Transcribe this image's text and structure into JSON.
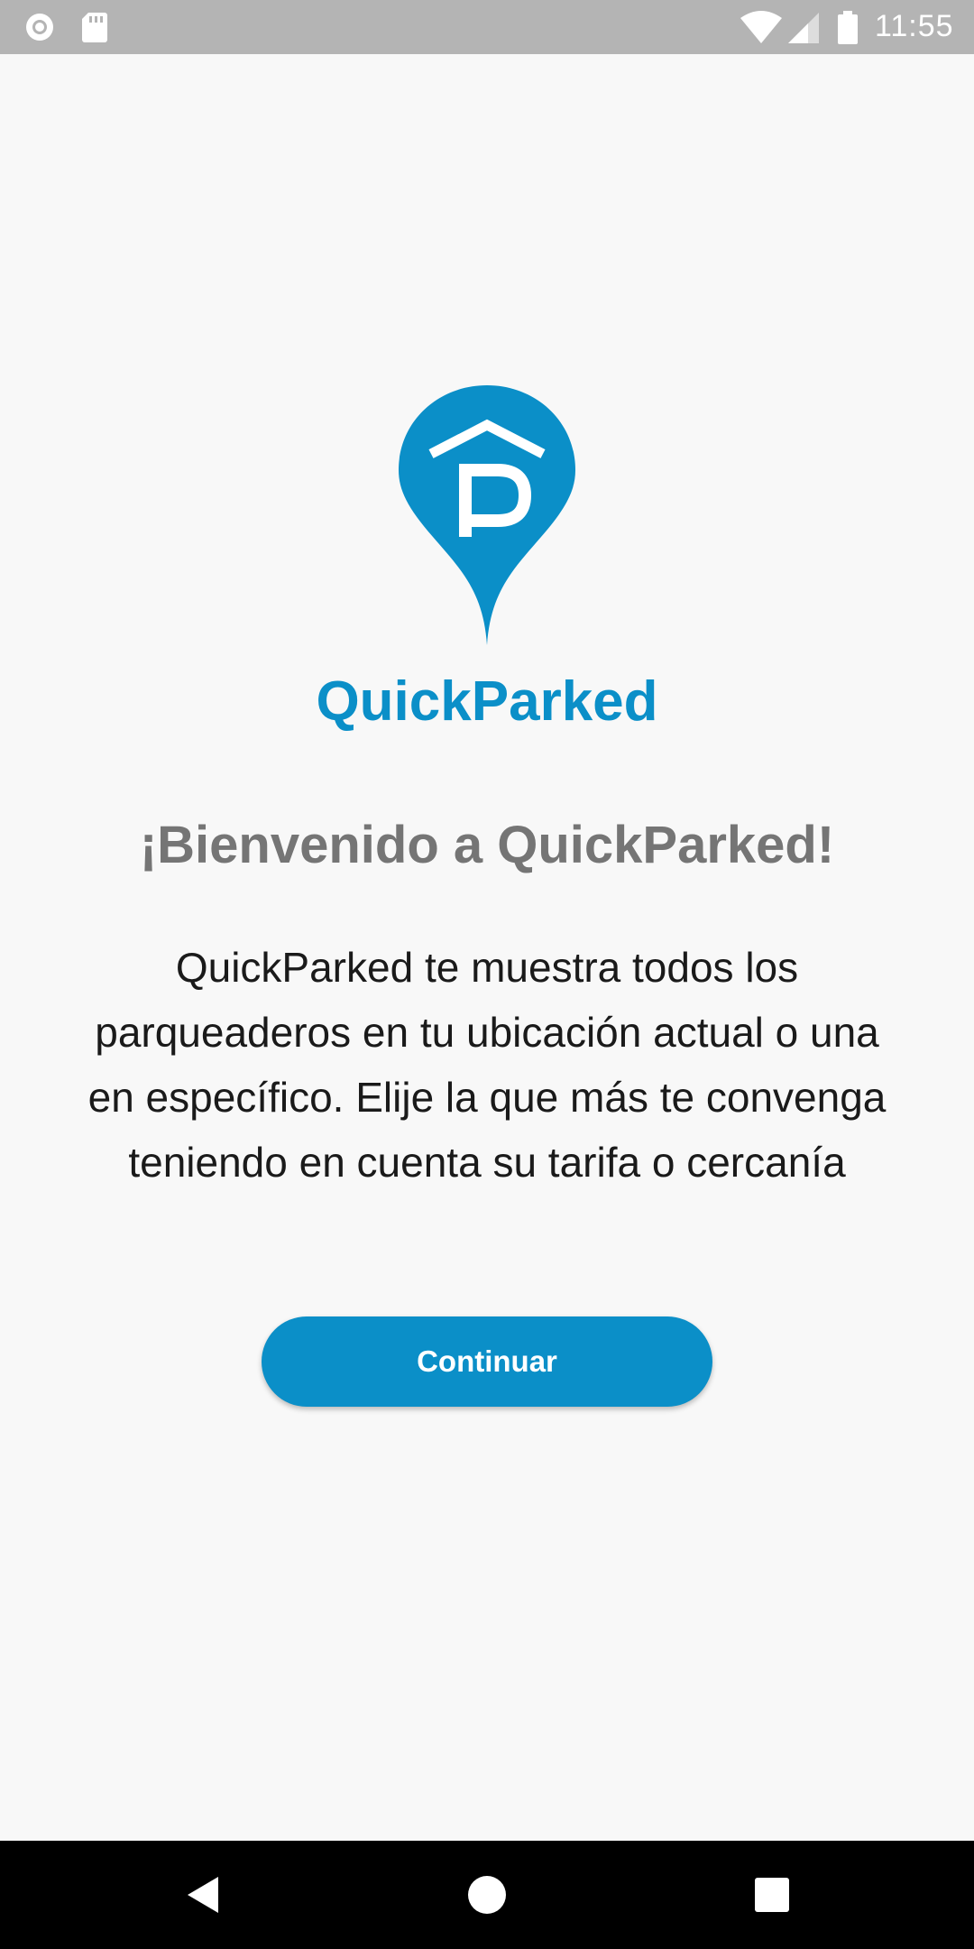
{
  "status_bar": {
    "time": "11:55",
    "icons": [
      "circle-notification-icon",
      "sd-card-icon",
      "wifi-icon",
      "signal-icon",
      "battery-icon"
    ]
  },
  "app": {
    "name": "QuickParked",
    "logo_icon": "parking-pin-icon",
    "logo_letter": "P"
  },
  "welcome": {
    "title": "¡Bienvenido a QuickParked!",
    "description": "QuickParked te muestra todos los parqueaderos en tu ubicación actual o una en específico. Elije la que más te convenga teniendo en cuenta su tarifa o cercanía"
  },
  "actions": {
    "continue_label": "Continuar"
  },
  "nav_bar": {
    "icons": [
      "back-icon",
      "home-icon",
      "recents-icon"
    ]
  },
  "colors": {
    "brand": "#0b8fc8",
    "status_bar": "#b4b4b4",
    "background": "#f8f8f8",
    "title_gray": "#757575"
  }
}
